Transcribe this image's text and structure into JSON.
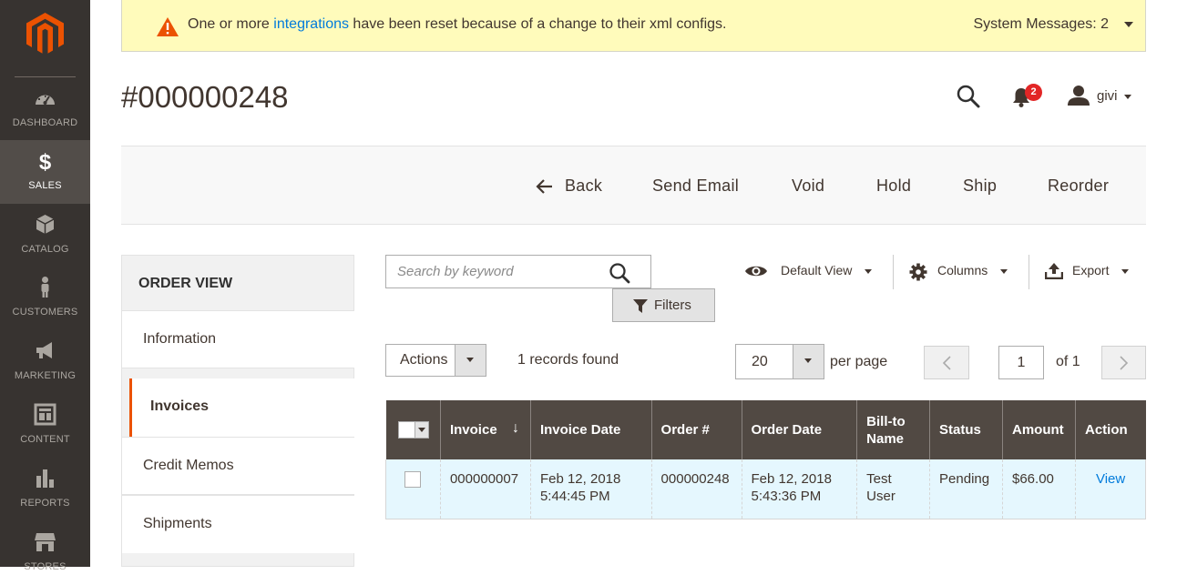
{
  "sidebar": {
    "items": [
      {
        "label": "Dashboard",
        "icon": "dashboard-icon"
      },
      {
        "label": "Sales",
        "icon": "dollar-icon",
        "active": true
      },
      {
        "label": "Catalog",
        "icon": "box-icon"
      },
      {
        "label": "Customers",
        "icon": "person-icon"
      },
      {
        "label": "Marketing",
        "icon": "megaphone-icon"
      },
      {
        "label": "Content",
        "icon": "layout-icon"
      },
      {
        "label": "Reports",
        "icon": "bar-chart-icon"
      },
      {
        "label": "Stores",
        "icon": "store-icon"
      }
    ]
  },
  "system_message": {
    "before": "One or more ",
    "link": "integrations",
    "after": " have been reset because of a change to their xml configs.",
    "count_label": "System Messages: 2"
  },
  "header": {
    "page_title": "#000000248",
    "notification_count": "2",
    "user_name": "givi"
  },
  "action_bar": {
    "back": "Back",
    "send_email": "Send Email",
    "void": "Void",
    "hold": "Hold",
    "ship": "Ship",
    "reorder": "Reorder"
  },
  "order_view": {
    "title": "ORDER VIEW",
    "tabs": [
      "Information",
      "Invoices",
      "Credit Memos",
      "Shipments"
    ],
    "selected_tab": "Invoices"
  },
  "grid": {
    "search_placeholder": "Search by keyword",
    "filters": "Filters",
    "default_view": "Default View",
    "columns": "Columns",
    "export": "Export",
    "actions": "Actions",
    "records_found": "1 records found",
    "per_page_value": "20",
    "per_page_label": "per page",
    "page_value": "1",
    "page_of": "of 1",
    "headers": {
      "invoice": "Invoice",
      "invoice_date": "Invoice Date",
      "order_no": "Order #",
      "order_date": "Order Date",
      "bill_to_name_1": "Bill-to",
      "bill_to_name_2": "Name",
      "status": "Status",
      "amount": "Amount",
      "action": "Action"
    },
    "sort_arrow": "↓",
    "rows": [
      {
        "invoice": "000000007",
        "invoice_date_1": "Feb 12, 2018",
        "invoice_date_2": "5:44:45 PM",
        "order_no": "000000248",
        "order_date_1": "Feb 12, 2018",
        "order_date_2": "5:43:36 PM",
        "bill_to_1": "Test",
        "bill_to_2": "User",
        "status": "Pending",
        "amount": "$66.00",
        "action": "View"
      }
    ]
  },
  "colors": {
    "sidebar_bg": "#373330",
    "sidebar_active": "#524d49",
    "accent": "#eb5202",
    "link": "#007bdb",
    "grid_header": "#514943",
    "grid_row": "#e5f7fe",
    "message_bg": "#fffbbb",
    "badge": "#e22626"
  }
}
